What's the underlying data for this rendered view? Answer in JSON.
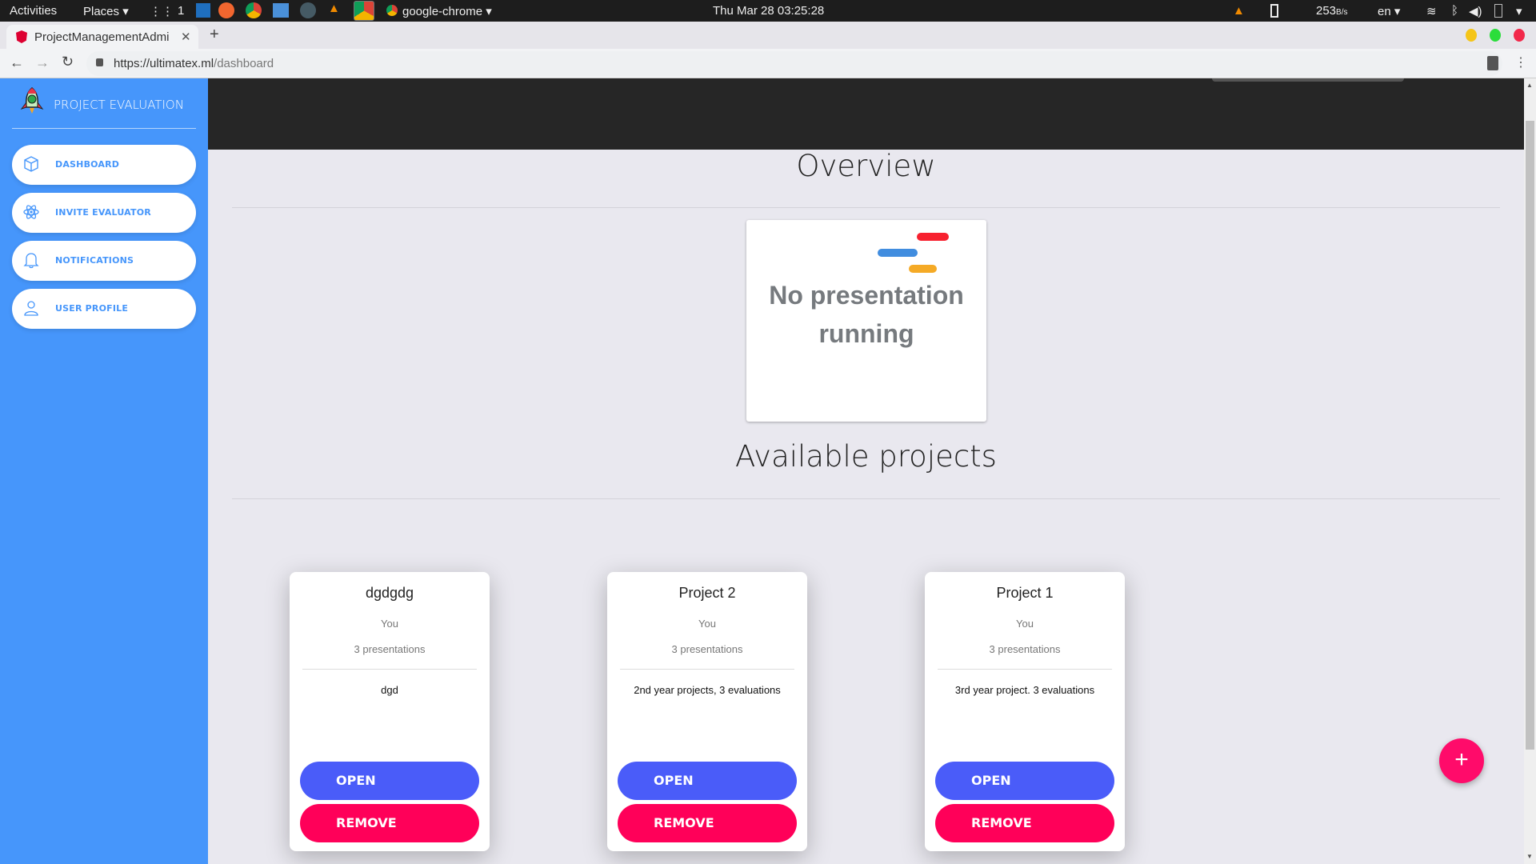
{
  "os_bar": {
    "activities": "Activities",
    "places": "Places",
    "workspace": "1",
    "app_name": "google-chrome",
    "clock": "Thu Mar 28  03:25:28",
    "net_speed": "253",
    "net_unit": "B/s",
    "lang": "en"
  },
  "browser": {
    "tab_title": "ProjectManagementAdmi",
    "url_host": "https://ultimatex.ml",
    "url_path": "/dashboard"
  },
  "sidebar": {
    "title": "PROJECT EVALUATION",
    "items": [
      {
        "label": "DASHBOARD",
        "icon": "cube-icon"
      },
      {
        "label": "INVITE EVALUATOR",
        "icon": "atom-icon"
      },
      {
        "label": "NOTIFICATIONS",
        "icon": "bell-icon"
      },
      {
        "label": "USER PROFILE",
        "icon": "user-icon"
      }
    ]
  },
  "main": {
    "overview_title": "Overview",
    "presentation_status_line1": "No presentation",
    "presentation_status_line2": "running",
    "projects_title": "Available projects",
    "projects": [
      {
        "name": "dgdgdg",
        "owner": "You",
        "presentations": "3 presentations",
        "description": "dgd",
        "open_label": "OPEN",
        "remove_label": "REMOVE"
      },
      {
        "name": "Project 2",
        "owner": "You",
        "presentations": "3 presentations",
        "description": "2nd year projects, 3 evaluations",
        "open_label": "OPEN",
        "remove_label": "REMOVE"
      },
      {
        "name": "Project 1",
        "owner": "You",
        "presentations": "3 presentations",
        "description": "3rd year project. 3 evaluations",
        "open_label": "OPEN",
        "remove_label": "REMOVE"
      }
    ],
    "fab_label": "+"
  },
  "colors": {
    "sidebar": "#4696fb",
    "open": "#4a5cf9",
    "remove": "#ff0059",
    "fab": "#ff0b6a",
    "header": "#262626"
  }
}
